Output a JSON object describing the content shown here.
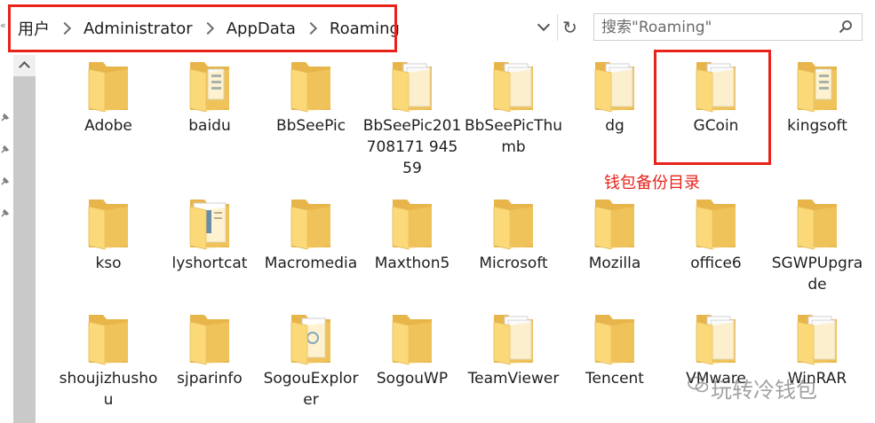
{
  "address_bar": {
    "edge_glyph": "«",
    "crumbs": [
      "用户",
      "Administrator",
      "AppData",
      "Roaming"
    ],
    "refresh_glyph": "↻"
  },
  "search": {
    "placeholder": "搜索\"Roaming\""
  },
  "annotation": {
    "text": "钱包备份目录",
    "color": "#e8231b"
  },
  "watermark": {
    "text": "玩转冷钱包"
  },
  "files": [
    {
      "name": "Adobe",
      "style": "plain"
    },
    {
      "name": "baidu",
      "style": "docs"
    },
    {
      "name": "BbSeePic",
      "style": "plain"
    },
    {
      "name": "BbSeePic201708171 94559",
      "style": "paper"
    },
    {
      "name": "BbSeePicThumb",
      "style": "paper"
    },
    {
      "name": "dg",
      "style": "paper"
    },
    {
      "name": "GCoin",
      "style": "paper"
    },
    {
      "name": "kingsoft",
      "style": "docs"
    },
    {
      "name": "kso",
      "style": "plain"
    },
    {
      "name": "lyshortcat",
      "style": "blue"
    },
    {
      "name": "Macromedia",
      "style": "plain"
    },
    {
      "name": "Maxthon5",
      "style": "plain"
    },
    {
      "name": "Microsoft",
      "style": "plain"
    },
    {
      "name": "Mozilla",
      "style": "plain"
    },
    {
      "name": "office6",
      "style": "plain"
    },
    {
      "name": "SGWPUpgrade",
      "style": "plain"
    },
    {
      "name": "shoujizhushou",
      "style": "plain"
    },
    {
      "name": "sjparinfo",
      "style": "plain"
    },
    {
      "name": "SogouExplorer",
      "style": "bluedoc"
    },
    {
      "name": "SogouWP",
      "style": "plain"
    },
    {
      "name": "TeamViewer",
      "style": "paper"
    },
    {
      "name": "Tencent",
      "style": "plain"
    },
    {
      "name": "VMware",
      "style": "paper"
    },
    {
      "name": "WinRAR",
      "style": "paper"
    }
  ],
  "colors": {
    "folder_back": "#e8b54a",
    "folder_front": "#fbd978",
    "annotation_red": "#e8231b",
    "scrollbar": "#c9c9c9"
  }
}
